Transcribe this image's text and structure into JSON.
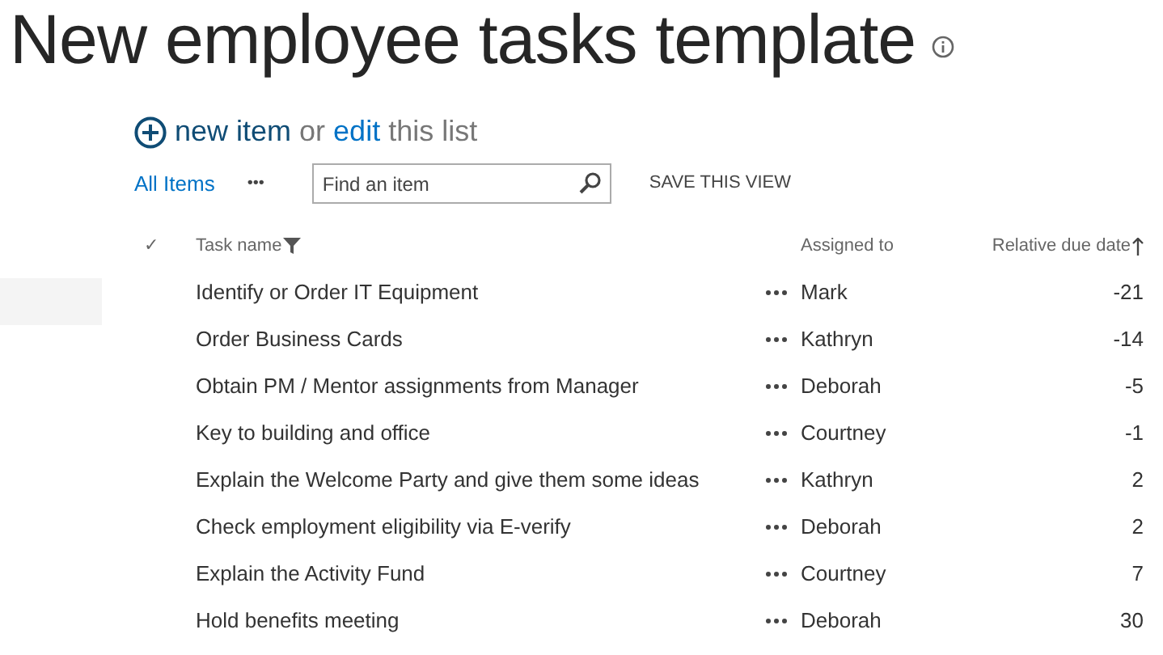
{
  "title": "New employee tasks template",
  "command_bar": {
    "new_link": "new item",
    "joiner": "or",
    "edit_link": "edit",
    "tail": "this list"
  },
  "toolbar": {
    "view": "All Items",
    "more": "•••",
    "search": {
      "placeholder": "Find an item"
    },
    "save": "SAVE THIS VIEW"
  },
  "table": {
    "check_header": "✓",
    "columns": [
      {
        "label": "Task name",
        "filtered": true,
        "sorted": false
      },
      {
        "label": "Assigned to",
        "filtered": false,
        "sorted": false
      },
      {
        "label": "Relative due date",
        "filtered": false,
        "sorted": true
      }
    ],
    "rows": [
      {
        "task": "Identify or Order IT Equipment",
        "assigned": "Mark",
        "due": "-21"
      },
      {
        "task": "Order Business Cards",
        "assigned": "Kathryn",
        "due": "-14"
      },
      {
        "task": "Obtain PM / Mentor assignments from Manager",
        "assigned": "Deborah",
        "due": "-5"
      },
      {
        "task": "Key to building and office",
        "assigned": "Courtney",
        "due": "-1"
      },
      {
        "task": "Explain the Welcome Party and give them some ideas",
        "assigned": "Kathryn",
        "due": "2"
      },
      {
        "task": "Check employment eligibility via E-verify",
        "assigned": "Deborah",
        "due": "2"
      },
      {
        "task": "Explain the Activity Fund",
        "assigned": "Courtney",
        "due": "7"
      },
      {
        "task": "Hold benefits meeting",
        "assigned": "Deborah",
        "due": "30"
      }
    ]
  }
}
